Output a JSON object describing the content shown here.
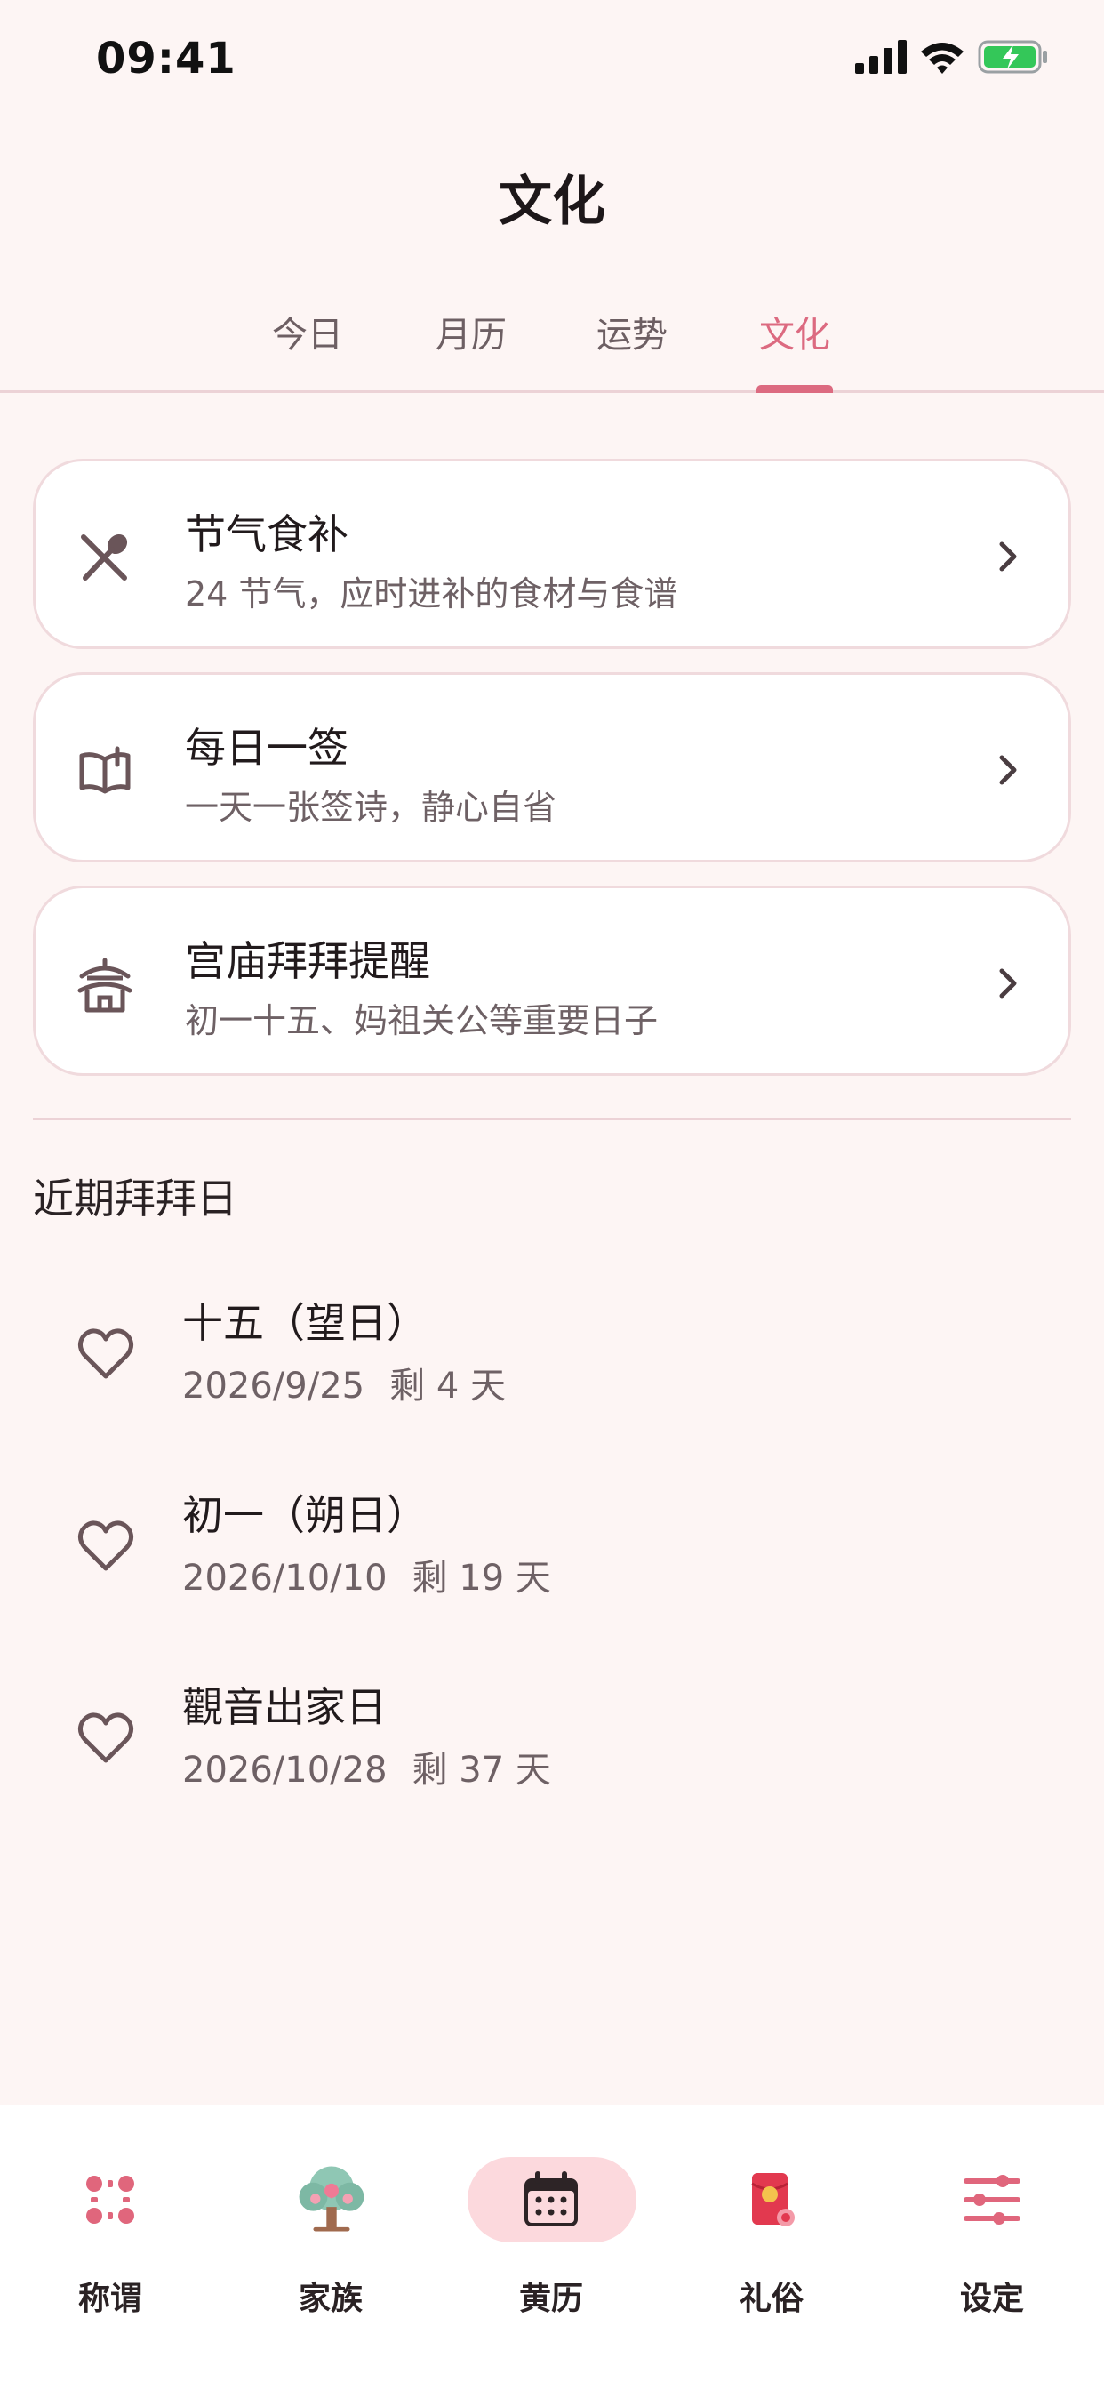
{
  "status_bar": {
    "time": "09:41"
  },
  "header": {
    "title": "文化"
  },
  "tabs": [
    {
      "label": "今日",
      "active": false
    },
    {
      "label": "月历",
      "active": false
    },
    {
      "label": "运势",
      "active": false
    },
    {
      "label": "文化",
      "active": true
    }
  ],
  "cards": [
    {
      "title": "节气食补",
      "subtitle": "24 节气，应时进补的食材与食谱",
      "icon": "utensils-icon"
    },
    {
      "title": "每日一签",
      "subtitle": "一天一张签诗，静心自省",
      "icon": "book-open-icon"
    },
    {
      "title": "宫庙拜拜提醒",
      "subtitle": "初一十五、妈祖关公等重要日子",
      "icon": "temple-icon"
    }
  ],
  "upcoming": {
    "title": "近期拜拜日",
    "items": [
      {
        "title": "十五（望日）",
        "date": "2026/9/25",
        "remaining": "剩 4 天",
        "icon": "heart-icon"
      },
      {
        "title": "初一（朔日）",
        "date": "2026/10/10",
        "remaining": "剩 19 天",
        "icon": "heart-icon"
      },
      {
        "title": "觀音出家日",
        "date": "2026/10/28",
        "remaining": "剩 37 天",
        "icon": "heart-icon"
      }
    ]
  },
  "bottom_nav": [
    {
      "label": "称谓",
      "icon": "dots-grid-icon",
      "active": false
    },
    {
      "label": "家族",
      "icon": "family-tree-icon",
      "active": false
    },
    {
      "label": "黄历",
      "icon": "calendar-icon",
      "active": true
    },
    {
      "label": "礼俗",
      "icon": "red-envelope-icon",
      "active": false
    },
    {
      "label": "设定",
      "icon": "sliders-icon",
      "active": false
    }
  ],
  "colors": {
    "accent": "#dc6a80",
    "background": "#fdf5f4",
    "active_pill": "#fcd9dd",
    "battery": "#34c759"
  }
}
